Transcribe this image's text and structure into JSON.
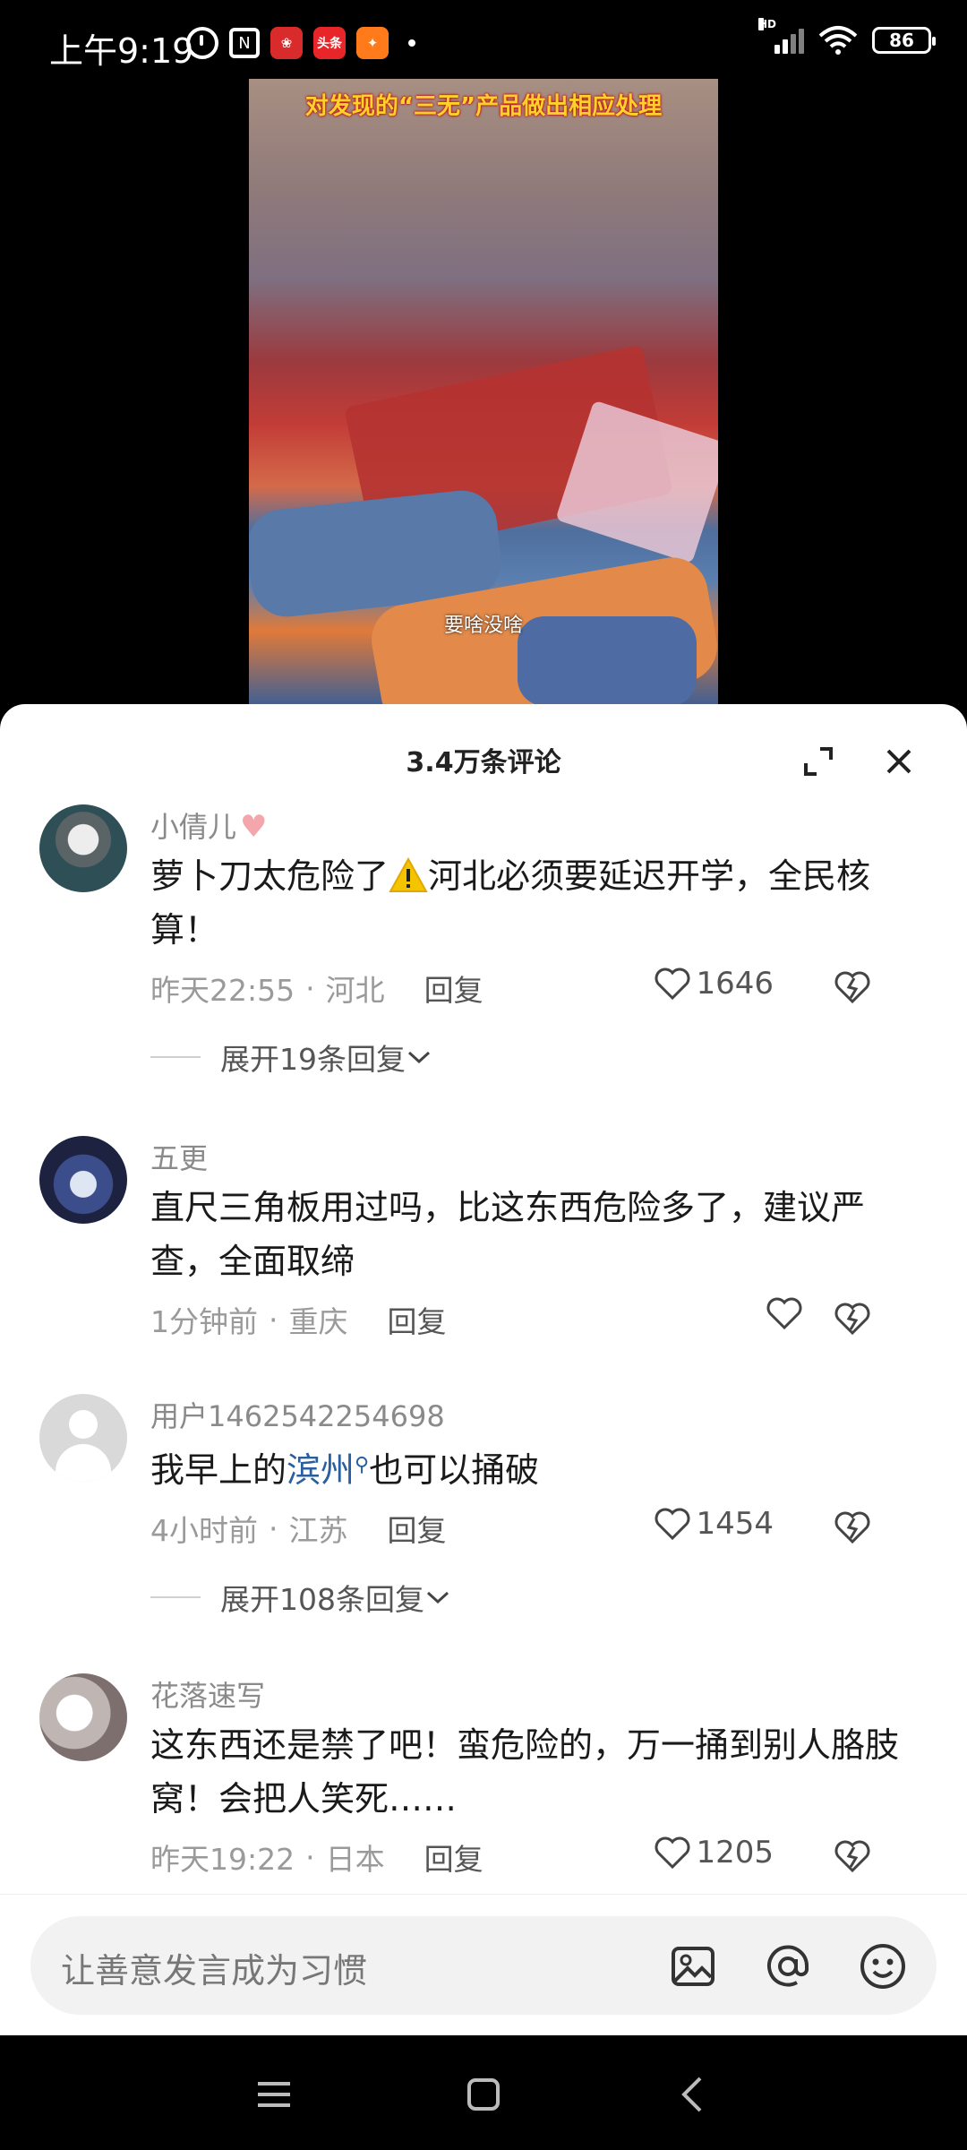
{
  "status_bar": {
    "time": "上午9:19",
    "app_icons": [
      "alarm-icon",
      "nfc-icon",
      "app-icon-red",
      "toutiao-icon",
      "app-icon-orange"
    ],
    "toutiao_label": "头条",
    "network_label": "HD",
    "battery": "86"
  },
  "video": {
    "title_text": "对发现的“三无”产品做出相应处理",
    "caption": "要啥没啥"
  },
  "sheet": {
    "title": "3.4万条评论"
  },
  "comments": [
    {
      "username": "小倩儿",
      "content_before": "萝卜刀太危险了",
      "content_after": "河北必须要延迟开学，全民核算！",
      "time": "昨天22:55",
      "location": "河北",
      "reply_label": "回复",
      "likes": "1646",
      "expand_label": "展开19条回复"
    },
    {
      "username": "五更",
      "content": "直尺三角板用过吗，比这东西危险多了，建议严查，全面取缔",
      "time": "1分钟前",
      "location": "重庆",
      "reply_label": "回复",
      "likes": ""
    },
    {
      "username": "用户1462542254698",
      "content_before": "我早上的",
      "content_link": "滨州",
      "content_after": "也可以捅破",
      "time": "4小时前",
      "location": "江苏",
      "reply_label": "回复",
      "likes": "1454",
      "expand_label": "展开108条回复"
    },
    {
      "username": "花落速写",
      "content": "这东西还是禁了吧！蛮危险的，万一捅到别人胳肢窝！会把人笑死……",
      "time": "昨天19:22",
      "location": "日本",
      "reply_label": "回复",
      "likes": "1205"
    }
  ],
  "input": {
    "placeholder": "让善意发言成为习惯"
  },
  "colors": {
    "link": "#2a5f9e",
    "muted": "#8a8a8a",
    "video_title": "#ffd12a"
  }
}
